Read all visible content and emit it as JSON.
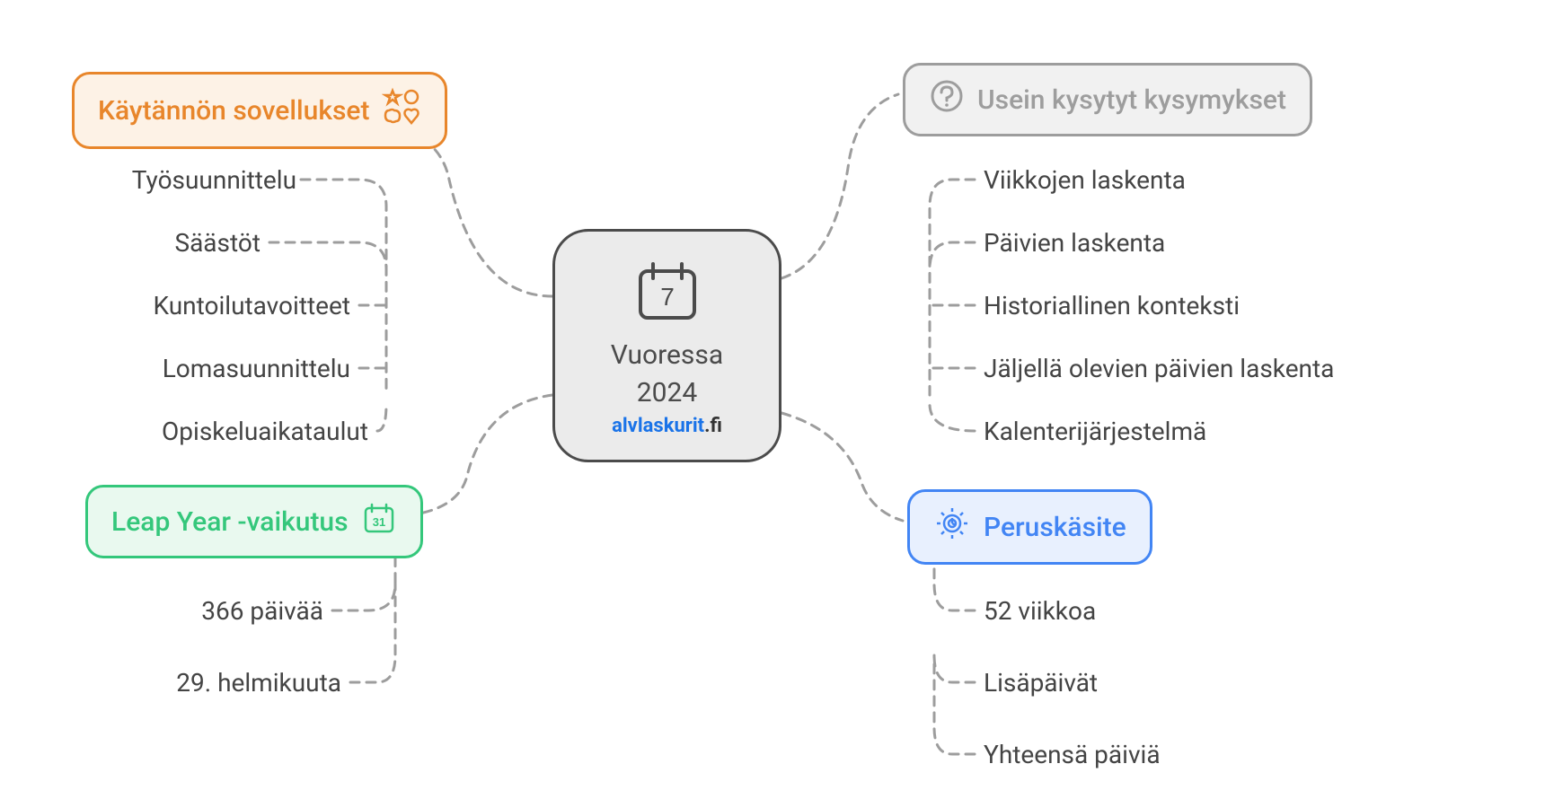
{
  "center": {
    "title_line1": "Vuoressa",
    "title_line2": "2024",
    "domain_part1": "alvlaskurit",
    "domain_part2": ".fi",
    "icon": "calendar-7-icon"
  },
  "branches": {
    "practical": {
      "label": "Käytännön sovellukset",
      "icon": "shapes-icon",
      "color": "orange",
      "items": [
        "Työsuunnittelu",
        "Säästöt",
        "Kuntoilutavoitteet",
        "Lomasuunnittelu",
        "Opiskeluaikataulut"
      ]
    },
    "leapyear": {
      "label": "Leap Year -vaikutus",
      "icon": "calendar-31-icon",
      "color": "green",
      "items": [
        "366 päivää",
        "29. helmikuuta"
      ]
    },
    "faq": {
      "label": "Usein kysytyt kysymykset",
      "icon": "question-icon",
      "color": "gray",
      "items": [
        "Viikkojen laskenta",
        "Päivien laskenta",
        "Historiallinen konteksti",
        "Jäljellä olevien päivien laskenta",
        "Kalenterijärjestelmä"
      ]
    },
    "concept": {
      "label": "Peruskäsite",
      "icon": "gear-icon",
      "color": "blue",
      "items": [
        "52 viikkoa",
        "Lisäpäivät",
        "Yhteensä päiviä"
      ]
    }
  }
}
